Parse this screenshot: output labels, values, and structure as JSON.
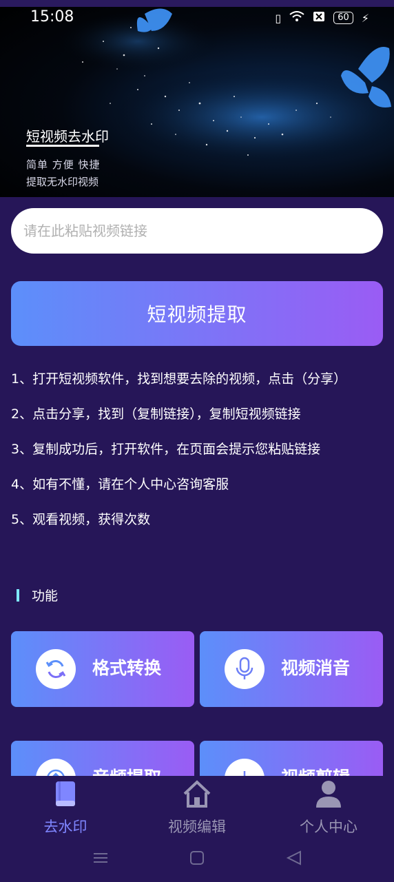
{
  "status_bar": {
    "time": "15:08",
    "battery": "60"
  },
  "banner": {
    "title": "短视频去水印",
    "subtitle1": "简单  方便  快捷",
    "subtitle2": "提取无水印视频"
  },
  "link_input": {
    "placeholder": "请在此粘贴视频链接"
  },
  "extract_button": {
    "label": "短视频提取"
  },
  "steps": [
    "1、打开短视频软件，找到想要去除的视频，点击（分享）",
    "2、点击分享，找到（复制链接），复制短视频链接",
    "3、复制成功后，打开软件，在页面会提示您粘贴链接",
    "4、如有不懂，请在个人中心咨询客服",
    "5、观看视频，获得次数"
  ],
  "section": {
    "title": "功能"
  },
  "features": [
    {
      "label": "格式转换",
      "icon": "refresh-icon"
    },
    {
      "label": "视频消音",
      "icon": "microphone-icon"
    },
    {
      "label": "音频提取",
      "icon": "upload-icon"
    },
    {
      "label": "视频剪辑",
      "icon": "scissors-icon"
    }
  ],
  "bottom_nav": {
    "items": [
      {
        "label": "去水印",
        "icon": "book-icon",
        "active": true
      },
      {
        "label": "视频编辑",
        "icon": "home-icon",
        "active": false
      },
      {
        "label": "个人中心",
        "icon": "person-icon",
        "active": false
      }
    ]
  },
  "colors": {
    "background": "#261658",
    "gradient_start": "#5c8ffa",
    "gradient_end": "#9a5cf4",
    "nav_active": "#7f86ff",
    "nav_inactive": "#9a96b4",
    "section_accent": "#7fe8ff"
  }
}
